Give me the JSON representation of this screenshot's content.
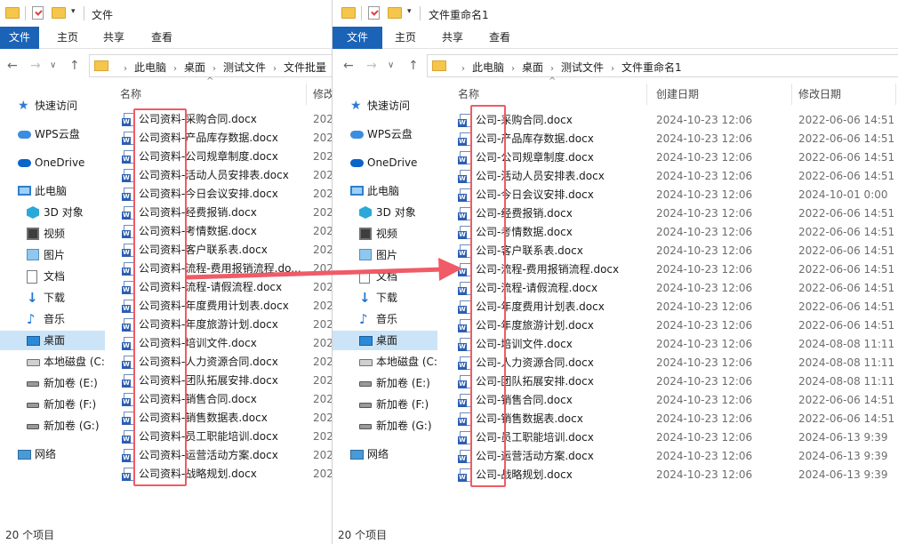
{
  "left": {
    "title": "文件",
    "ribbon_tabs": [
      "文件",
      "主页",
      "共享",
      "查看"
    ],
    "breadcrumbs": [
      "此电脑",
      "桌面",
      "测试文件",
      "文件批量"
    ],
    "col_name": "名称",
    "col_modified": "修改",
    "status": "20 个项目",
    "files": [
      {
        "name": "公司资料-采购合同.docx",
        "mod": "202"
      },
      {
        "name": "公司资料-产品库存数据.docx",
        "mod": "202"
      },
      {
        "name": "公司资料-公司规章制度.docx",
        "mod": "202"
      },
      {
        "name": "公司资料-活动人员安排表.docx",
        "mod": "202"
      },
      {
        "name": "公司资料-今日会议安排.docx",
        "mod": "202"
      },
      {
        "name": "公司资料-经费报销.docx",
        "mod": "202"
      },
      {
        "name": "公司资料-考情数据.docx",
        "mod": "202"
      },
      {
        "name": "公司资料-客户联系表.docx",
        "mod": "202"
      },
      {
        "name": "公司资料-流程-费用报销流程.do...",
        "mod": "202"
      },
      {
        "name": "公司资料-流程-请假流程.docx",
        "mod": "202"
      },
      {
        "name": "公司资料-年度费用计划表.docx",
        "mod": "202"
      },
      {
        "name": "公司资料-年度旅游计划.docx",
        "mod": "202"
      },
      {
        "name": "公司资料-培训文件.docx",
        "mod": "202"
      },
      {
        "name": "公司资料-人力资源合同.docx",
        "mod": "202"
      },
      {
        "name": "公司资料-团队拓展安排.docx",
        "mod": "202"
      },
      {
        "name": "公司资料-销售合同.docx",
        "mod": "202"
      },
      {
        "name": "公司资料-销售数据表.docx",
        "mod": "202"
      },
      {
        "name": "公司资料-员工职能培训.docx",
        "mod": "202"
      },
      {
        "name": "公司资料-运营活动方案.docx",
        "mod": "202"
      },
      {
        "name": "公司资料-战略规划.docx",
        "mod": "202"
      }
    ]
  },
  "right": {
    "title": "文件重命名1",
    "ribbon_tabs": [
      "文件",
      "主页",
      "共享",
      "查看"
    ],
    "breadcrumbs": [
      "此电脑",
      "桌面",
      "测试文件",
      "文件重命名1"
    ],
    "col_name": "名称",
    "col_created": "创建日期",
    "col_modified": "修改日期",
    "status": "20 个项目",
    "files": [
      {
        "name": "公司-采购合同.docx",
        "created": "2024-10-23 12:06",
        "mod": "2022-06-06 14:51"
      },
      {
        "name": "公司-产品库存数据.docx",
        "created": "2024-10-23 12:06",
        "mod": "2022-06-06 14:51"
      },
      {
        "name": "公司-公司规章制度.docx",
        "created": "2024-10-23 12:06",
        "mod": "2022-06-06 14:51"
      },
      {
        "name": "公司-活动人员安排表.docx",
        "created": "2024-10-23 12:06",
        "mod": "2022-06-06 14:51"
      },
      {
        "name": "公司-今日会议安排.docx",
        "created": "2024-10-23 12:06",
        "mod": "2024-10-01 0:00"
      },
      {
        "name": "公司-经费报销.docx",
        "created": "2024-10-23 12:06",
        "mod": "2022-06-06 14:51"
      },
      {
        "name": "公司-考情数据.docx",
        "created": "2024-10-23 12:06",
        "mod": "2022-06-06 14:51"
      },
      {
        "name": "公司-客户联系表.docx",
        "created": "2024-10-23 12:06",
        "mod": "2022-06-06 14:51"
      },
      {
        "name": "公司-流程-费用报销流程.docx",
        "created": "2024-10-23 12:06",
        "mod": "2022-06-06 14:51"
      },
      {
        "name": "公司-流程-请假流程.docx",
        "created": "2024-10-23 12:06",
        "mod": "2022-06-06 14:51"
      },
      {
        "name": "公司-年度费用计划表.docx",
        "created": "2024-10-23 12:06",
        "mod": "2022-06-06 14:51"
      },
      {
        "name": "公司-年度旅游计划.docx",
        "created": "2024-10-23 12:06",
        "mod": "2022-06-06 14:51"
      },
      {
        "name": "公司-培训文件.docx",
        "created": "2024-10-23 12:06",
        "mod": "2024-08-08 11:11"
      },
      {
        "name": "公司-人力资源合同.docx",
        "created": "2024-10-23 12:06",
        "mod": "2024-08-08 11:11"
      },
      {
        "name": "公司-团队拓展安排.docx",
        "created": "2024-10-23 12:06",
        "mod": "2024-08-08 11:11"
      },
      {
        "name": "公司-销售合同.docx",
        "created": "2024-10-23 12:06",
        "mod": "2022-06-06 14:51"
      },
      {
        "name": "公司-销售数据表.docx",
        "created": "2024-10-23 12:06",
        "mod": "2022-06-06 14:51"
      },
      {
        "name": "公司-员工职能培训.docx",
        "created": "2024-10-23 12:06",
        "mod": "2024-06-13 9:39"
      },
      {
        "name": "公司-运营活动方案.docx",
        "created": "2024-10-23 12:06",
        "mod": "2024-06-13 9:39"
      },
      {
        "name": "公司-战略规划.docx",
        "created": "2024-10-23 12:06",
        "mod": "2024-06-13 9:39"
      }
    ]
  },
  "sidebar": [
    {
      "label": "快速访问",
      "icon": "quick-access-star-icon"
    },
    {
      "label": "WPS云盘",
      "icon": "wps-cloud-icon"
    },
    {
      "label": "OneDrive",
      "icon": "onedrive-cloud-icon"
    },
    {
      "label": "此电脑",
      "icon": "this-pc-icon"
    },
    {
      "label": "3D 对象",
      "icon": "3d-objects-icon"
    },
    {
      "label": "视频",
      "icon": "videos-icon"
    },
    {
      "label": "图片",
      "icon": "pictures-icon"
    },
    {
      "label": "文档",
      "icon": "documents-icon"
    },
    {
      "label": "下载",
      "icon": "downloads-icon"
    },
    {
      "label": "音乐",
      "icon": "music-icon"
    },
    {
      "label": "桌面",
      "icon": "desktop-icon"
    },
    {
      "label": "本地磁盘 (C:",
      "icon": "local-disk-icon"
    },
    {
      "label": "新加卷 (E:)",
      "icon": "drive-icon"
    },
    {
      "label": "新加卷 (F:)",
      "icon": "drive-icon"
    },
    {
      "label": "新加卷 (G:)",
      "icon": "drive-icon"
    },
    {
      "label": "网络",
      "icon": "network-icon"
    }
  ],
  "colors": {
    "accent": "#1a63b7",
    "highlight": "#ef5b66",
    "selection": "#cce4f7"
  }
}
